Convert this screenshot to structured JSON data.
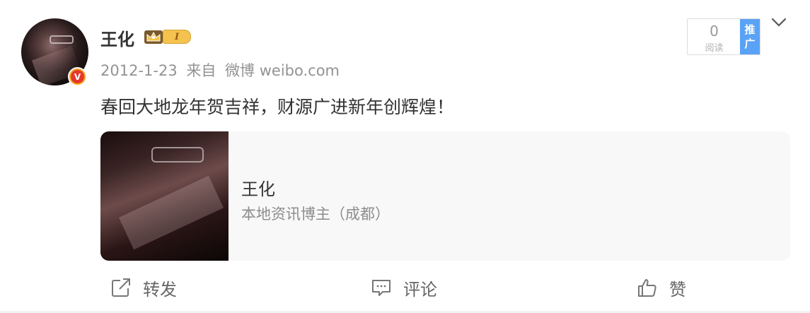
{
  "post": {
    "author": "王化",
    "level": "I",
    "verified_badge": "V",
    "meta": {
      "date": "2012-1-23",
      "source_prefix": "来自",
      "source": "微博 weibo.com"
    },
    "text": "春回大地龙年贺吉祥，财源广进新年创辉煌！",
    "read_count": "0",
    "read_label": "阅读",
    "promote_label": "推广"
  },
  "card": {
    "title": "王化",
    "subtitle": "本地资讯博主（成都）"
  },
  "actions": {
    "forward": "转发",
    "comment": "评论",
    "like": "赞"
  },
  "icons": [
    "avatar",
    "verified-badge",
    "crown-icon",
    "chevron-down-icon",
    "forward-icon",
    "comment-icon",
    "like-icon"
  ],
  "colors": {
    "promo_blue": "#5aa2f5",
    "verified_red": "#e6372c",
    "level_gold": "#f4c24e",
    "muted_text": "#939393"
  }
}
